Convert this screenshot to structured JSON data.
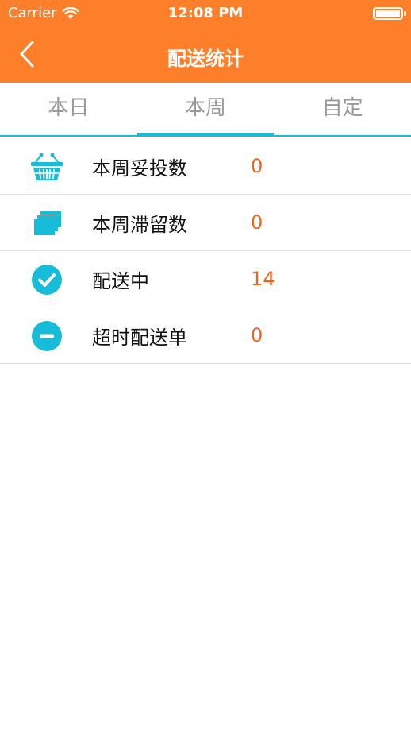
{
  "status_bar": {
    "carrier": "Carrier",
    "time": "12:08 PM"
  },
  "nav": {
    "title": "配送统计",
    "back_icon": "chevron-left-icon"
  },
  "tabs": [
    {
      "label": "本日",
      "active": false
    },
    {
      "label": "本周",
      "active": true
    },
    {
      "label": "自定",
      "active": false
    }
  ],
  "stats": [
    {
      "icon": "basket-icon",
      "label": "本周妥投数",
      "value": "0"
    },
    {
      "icon": "stacked-cards-icon",
      "label": "本周滞留数",
      "value": "0"
    },
    {
      "icon": "check-circle-icon",
      "label": "配送中",
      "value": "14"
    },
    {
      "icon": "minus-circle-icon",
      "label": "超时配送单",
      "value": "0"
    }
  ],
  "colors": {
    "header": "#fd7f2a",
    "accent": "#17bcd8",
    "value": "#f0621f"
  }
}
